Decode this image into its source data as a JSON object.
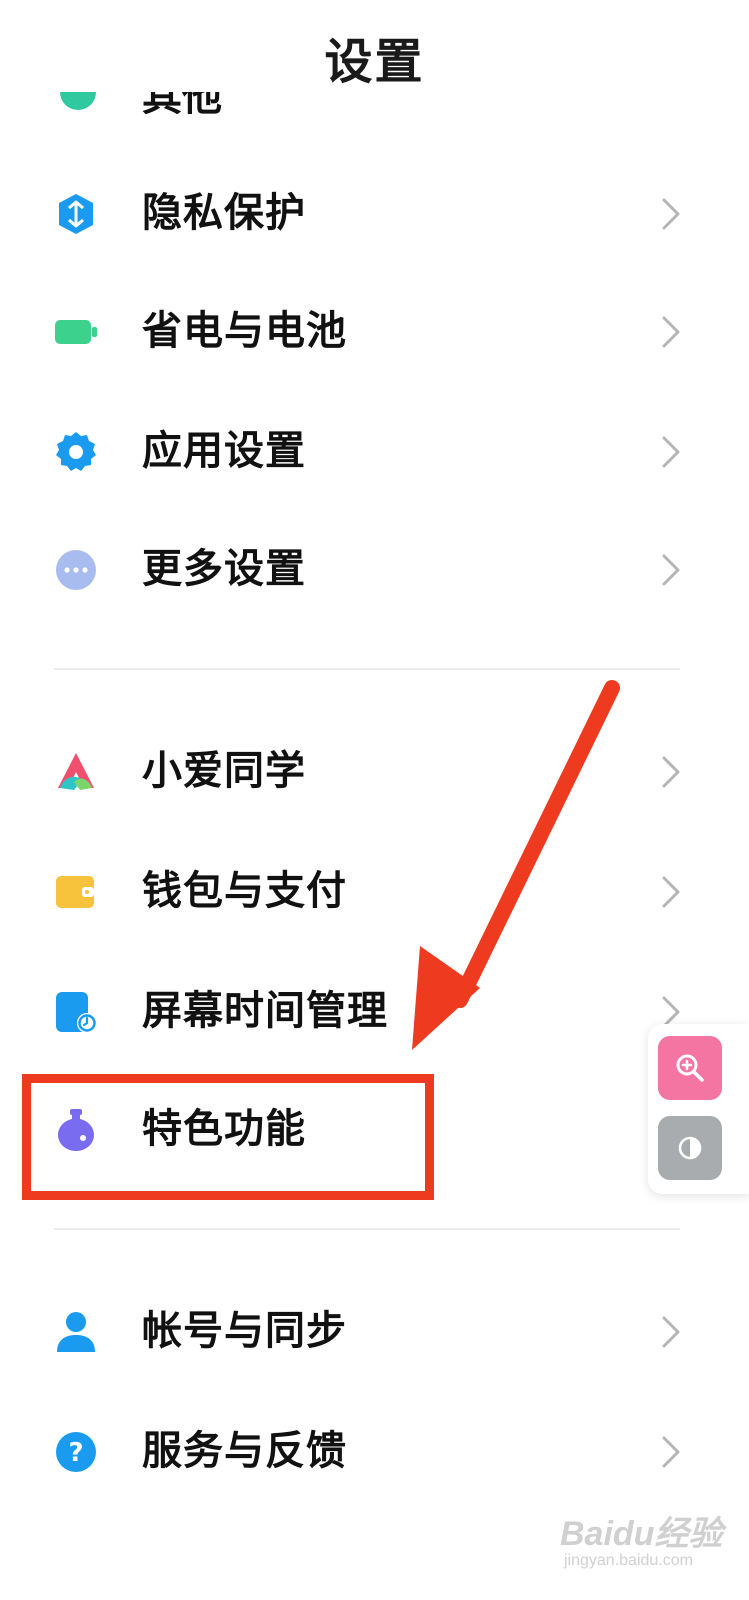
{
  "header": {
    "title": "设置"
  },
  "partial_item": {
    "label": "其他"
  },
  "sections": [
    {
      "items": [
        {
          "label": "隐私保护",
          "icon": "privacy-shield-icon",
          "color": "#1a9bf0"
        },
        {
          "label": "省电与电池",
          "icon": "battery-icon",
          "color": "#3dd18e"
        },
        {
          "label": "应用设置",
          "icon": "gear-icon",
          "color": "#1a9bf0"
        },
        {
          "label": "更多设置",
          "icon": "more-dots-icon",
          "color": "#a8bcef"
        }
      ]
    },
    {
      "items": [
        {
          "label": "小爱同学",
          "icon": "xiaoai-icon",
          "color": "#f0506e"
        },
        {
          "label": "钱包与支付",
          "icon": "wallet-icon",
          "color": "#f7c33c"
        },
        {
          "label": "屏幕时间管理",
          "icon": "screen-time-icon",
          "color": "#1a9bf0"
        },
        {
          "label": "特色功能",
          "icon": "flask-icon",
          "color": "#7a6cf0"
        }
      ]
    },
    {
      "items": [
        {
          "label": "帐号与同步",
          "icon": "account-icon",
          "color": "#1a9bf0"
        },
        {
          "label": "服务与反馈",
          "icon": "help-icon",
          "color": "#1a9bf0"
        }
      ]
    }
  ],
  "floating_tools": [
    {
      "icon": "zoom-in-icon",
      "color": "#f475a1"
    },
    {
      "icon": "contrast-icon",
      "color": "#a9acaf"
    }
  ],
  "annotation": {
    "highlight_color": "#ee3a1f"
  },
  "watermark": {
    "main": "Baidu经验",
    "sub": "jingyan.baidu.com"
  }
}
